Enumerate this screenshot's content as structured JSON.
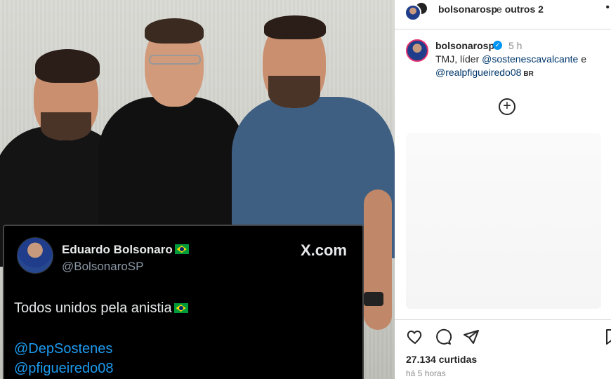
{
  "tweet": {
    "name": "Eduardo Bolsonaro",
    "handle": "@BolsonaroSP",
    "site": "X.com",
    "text": "Todos unidos pela anistia",
    "mention1": "@DepSostenes",
    "mention2": "@pfigueiredo08"
  },
  "instagram": {
    "header_user": "bolsonarosp",
    "header_others_prefix": "e",
    "header_others": "outros 2",
    "more_icon": "•",
    "post_user": "bolsonarosp",
    "verified_icon": "✓",
    "post_time": "5 h",
    "caption_text": "TMJ, líder",
    "caption_link1": "@sostenescavalcante",
    "caption_and": "e",
    "caption_link2": "@realpfigueiredo08",
    "caption_lang": "BR",
    "plus_icon": "+",
    "likes": "27.134 curtidas",
    "time_ago": "há 5 horas"
  },
  "colors": {
    "tweet_bg": "#000000",
    "tweet_link": "#1d9bf0",
    "ig_link": "#00376b",
    "ig_verified": "#0095f6"
  },
  "icons": [
    "heart-icon",
    "comment-icon",
    "share-icon",
    "bookmark-icon",
    "brazil-flag-icon",
    "x-logo"
  ]
}
